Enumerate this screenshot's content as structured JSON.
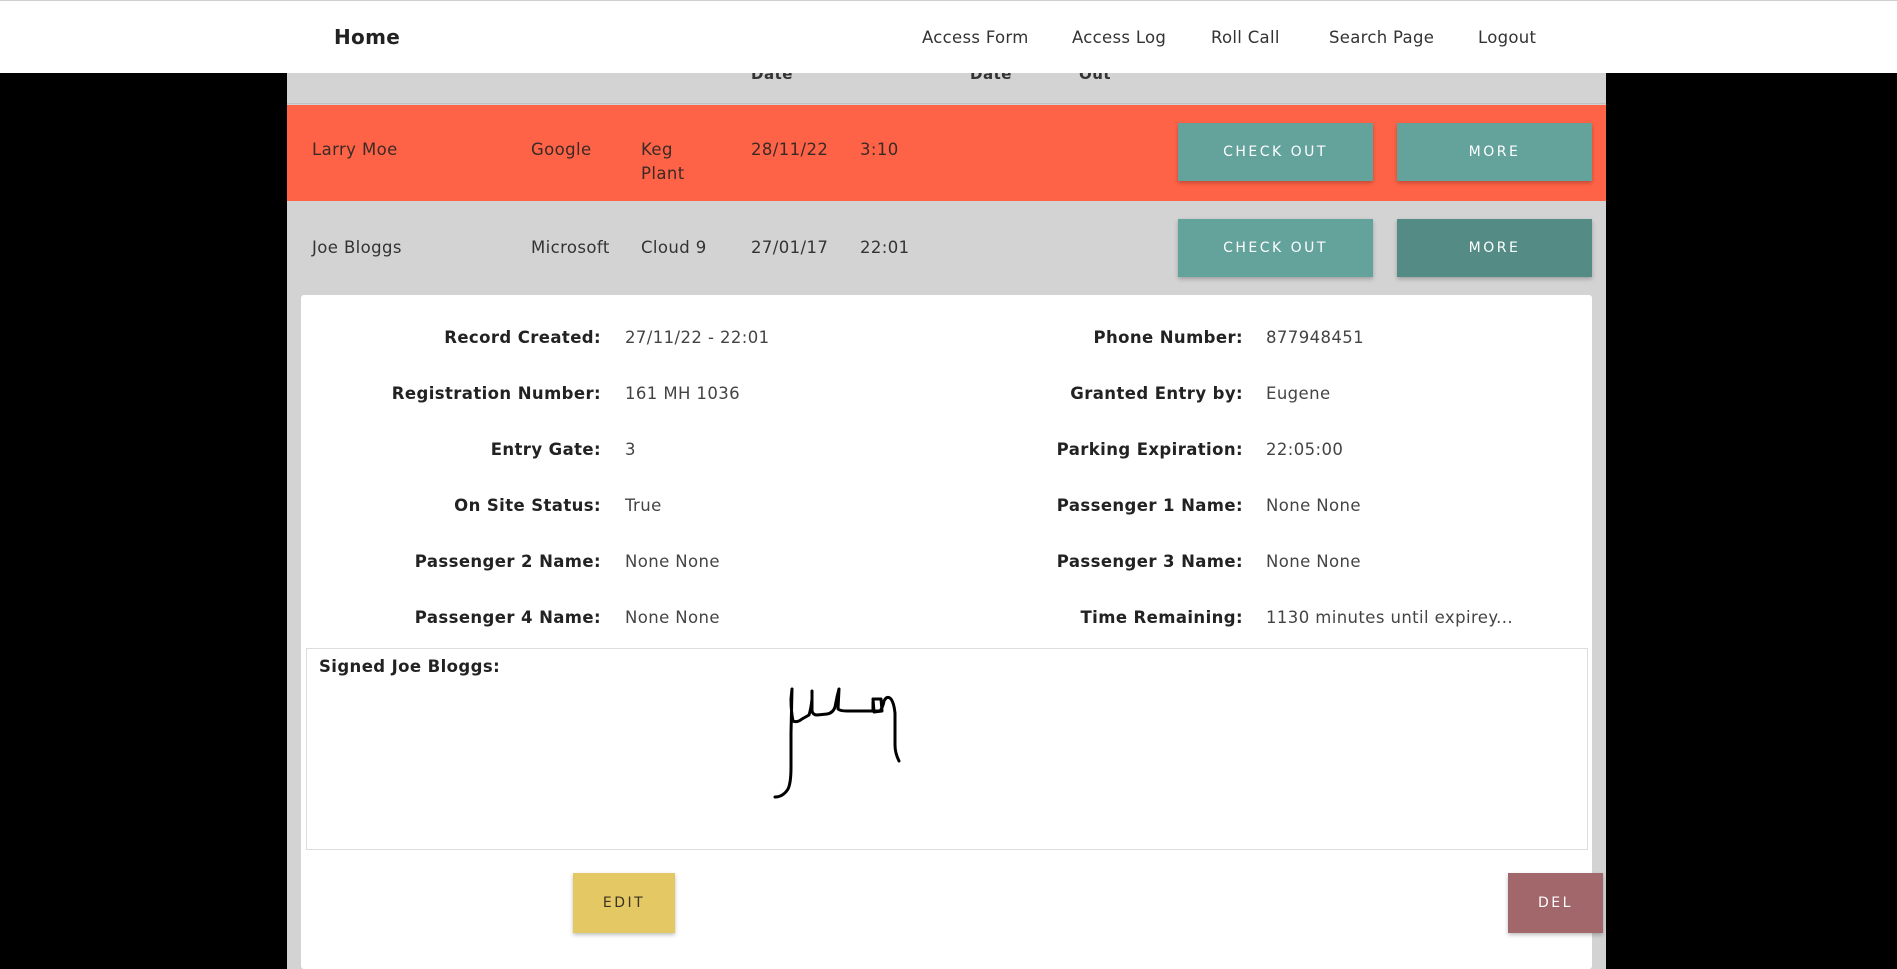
{
  "navbar": {
    "brand": "Home",
    "links": [
      "Access Form",
      "Access Log",
      "Roll Call",
      "Search Page",
      "Logout"
    ]
  },
  "table": {
    "headers": {
      "entry_date": "Date",
      "exit_date": "Date",
      "time_out": "Out"
    },
    "rows": [
      {
        "name": "Larry Moe",
        "company": "Google",
        "location": "Keg Plant",
        "date": "28/11/22",
        "time": "3:10",
        "checkout_label": "CHECK OUT",
        "more_label": "MORE",
        "color": "#ff6347"
      },
      {
        "name": "Joe Bloggs",
        "company": "Microsoft",
        "location": "Cloud 9",
        "date": "27/01/17",
        "time": "22:01",
        "checkout_label": "CHECK OUT",
        "more_label": "MORE",
        "color": "#d3d3d3"
      }
    ]
  },
  "details": {
    "record_created_label": "Record Created:",
    "record_created": "27/11/22 - 22:01",
    "phone_label": "Phone Number:",
    "phone": "877948451",
    "registration_label": "Registration Number:",
    "registration": "161 MH 1036",
    "granted_label": "Granted Entry by:",
    "granted": "Eugene",
    "gate_label": "Entry Gate:",
    "gate": "3",
    "parking_label": "Parking Expiration:",
    "parking": "22:05:00",
    "onsite_label": "On Site Status:",
    "onsite": "True",
    "p1_label": "Passenger 1 Name:",
    "p1": "None None",
    "p2_label": "Passenger 2 Name:",
    "p2": "None None",
    "p3_label": "Passenger 3 Name:",
    "p3": "None None",
    "p4_label": "Passenger 4 Name:",
    "p4": "None None",
    "remaining_label": "Time Remaining:",
    "remaining": "1130 minutes until expirey...",
    "signed_label": "Signed Joe Bloggs:",
    "edit_label": "EDIT",
    "del_label": "DEL"
  },
  "colors": {
    "row_highlight": "#ff6347",
    "teal": "#64a29c",
    "teal_dark": "#548b85",
    "edit": "#e4c863",
    "delete": "#a1676b"
  }
}
